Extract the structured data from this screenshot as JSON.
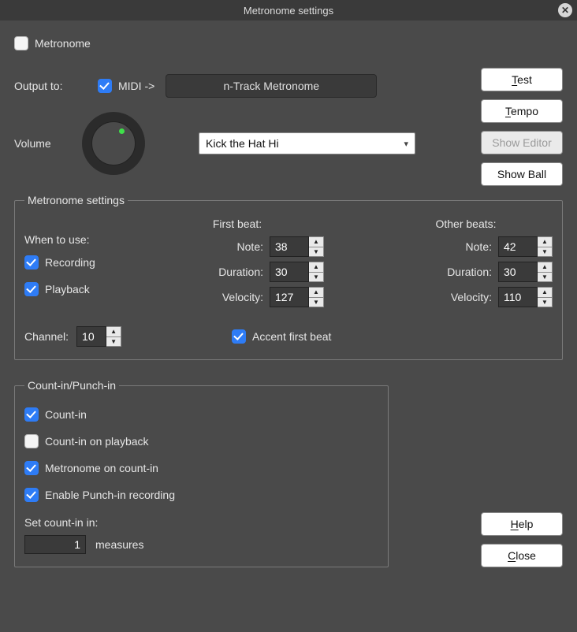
{
  "title": "Metronome settings",
  "metronome_enable_label": "Metronome",
  "output_to_label": "Output to:",
  "midi_label": "MIDI ->",
  "device_button": "n-Track Metronome",
  "volume_label": "Volume",
  "kit_select": "Kick the Hat Hi",
  "buttons": {
    "test": "Test",
    "tempo": "Tempo",
    "show_editor": "Show Editor",
    "show_ball": "Show Ball",
    "help": "Help",
    "close": "Close"
  },
  "settings_legend": "Metronome settings",
  "when_to_use_label": "When to use:",
  "recording_label": "Recording",
  "playback_label": "Playback",
  "first_beat_label": "First beat:",
  "other_beats_label": "Other beats:",
  "note_label": "Note:",
  "duration_label": "Duration:",
  "velocity_label": "Velocity:",
  "first_beat": {
    "note": "38",
    "duration": "30",
    "velocity": "127"
  },
  "other_beats": {
    "note": "42",
    "duration": "30",
    "velocity": "110"
  },
  "channel_label": "Channel:",
  "channel_value": "10",
  "accent_label": "Accent first beat",
  "countin_legend": "Count-in/Punch-in",
  "countin_label": "Count-in",
  "countin_playback_label": "Count-in on playback",
  "metronome_countin_label": "Metronome on count-in",
  "punchin_label": "Enable Punch-in recording",
  "set_countin_label": "Set count-in in:",
  "measures_label": "measures",
  "measures_value": "1"
}
